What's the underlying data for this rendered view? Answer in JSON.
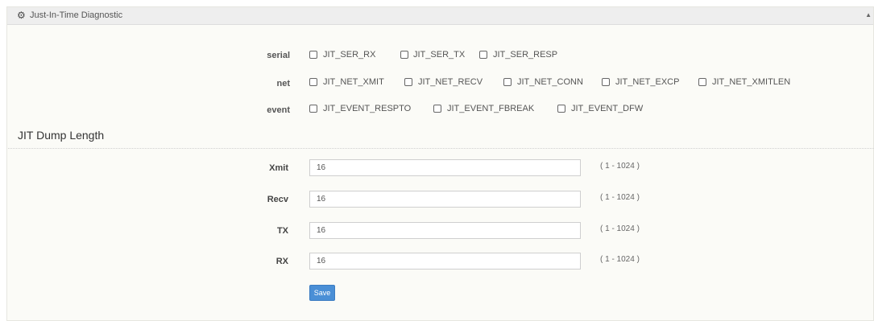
{
  "panel": {
    "title": "Just-In-Time Diagnostic",
    "icon": "gear-icon"
  },
  "diagnostics": {
    "serial": {
      "label": "serial",
      "options": [
        "JIT_SER_RX",
        "JIT_SER_TX",
        "JIT_SER_RESP"
      ]
    },
    "net": {
      "label": "net",
      "options": [
        "JIT_NET_XMIT",
        "JIT_NET_RECV",
        "JIT_NET_CONN",
        "JIT_NET_EXCP",
        "JIT_NET_XMITLEN"
      ]
    },
    "event": {
      "label": "event",
      "options": [
        "JIT_EVENT_RESPTO",
        "JIT_EVENT_FBREAK",
        "JIT_EVENT_DFW"
      ]
    }
  },
  "dump": {
    "title": "JIT Dump Length",
    "fields": [
      {
        "label": "Xmit",
        "value": "16",
        "range": "( 1 - 1024 )"
      },
      {
        "label": "Recv",
        "value": "16",
        "range": "( 1 - 1024 )"
      },
      {
        "label": "TX",
        "value": "16",
        "range": "( 1 - 1024 )"
      },
      {
        "label": "RX",
        "value": "16",
        "range": "( 1 - 1024 )"
      }
    ],
    "save_label": "Save"
  }
}
